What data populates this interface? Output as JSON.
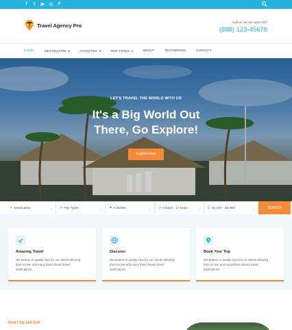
{
  "social_icons": [
    "facebook-icon",
    "twitter-icon",
    "youtube-icon",
    "instagram-icon",
    "pinterest-icon"
  ],
  "header": {
    "brand": "Travel Agency Pro",
    "call_label": "Call us, we are open 24/7",
    "phone": "(888) 123-45678"
  },
  "nav": {
    "items": [
      {
        "label": "HOME",
        "active": true,
        "dropdown": false
      },
      {
        "label": "DESTINATION",
        "active": false,
        "dropdown": true
      },
      {
        "label": "ACTIVITIES",
        "active": false,
        "dropdown": true
      },
      {
        "label": "TRIP TYPES",
        "active": false,
        "dropdown": true
      },
      {
        "label": "ABOUT",
        "active": false,
        "dropdown": false
      },
      {
        "label": "TESTIMONIAL",
        "active": false,
        "dropdown": false
      },
      {
        "label": "CONTACT",
        "active": false,
        "dropdown": false
      }
    ]
  },
  "hero": {
    "kicker": "LET'S TRAVEL THE WORLD WITH US",
    "title": "It's a Big World Out There, Go Explore!",
    "button": "Explore Now"
  },
  "search": {
    "fields": [
      {
        "label": "Destination",
        "icon": "pin-icon"
      },
      {
        "label": "Trip Types",
        "icon": "plane-icon"
      },
      {
        "label": "Activities",
        "icon": "flag-icon"
      },
      {
        "label": "0 Days - 17 Days",
        "icon": "clock-icon"
      },
      {
        "label": "$1,100 - $2,000",
        "icon": "money-icon"
      }
    ],
    "button": "SEARCH"
  },
  "features": [
    {
      "title": "Amazing Travel",
      "text": "We believe in quality trips for our clients allowing them to live and enjoy there dream travel destinations.",
      "icon": "plane-icon"
    },
    {
      "title": "Discover",
      "text": "We believe in quality trips for our clients allowing them to live and enjoy there dream travel destinations.",
      "icon": "globe-icon"
    },
    {
      "title": "Book Your Trip",
      "text": "We believe in quality trips for our clients allowing them to live and enjoy there dream travel destinations.",
      "icon": "map-pin-icon"
    }
  ],
  "aim_label": "WHAT WE AIM FOR",
  "colors": {
    "accent_blue": "#27b2dd",
    "accent_orange": "#f58a38"
  }
}
